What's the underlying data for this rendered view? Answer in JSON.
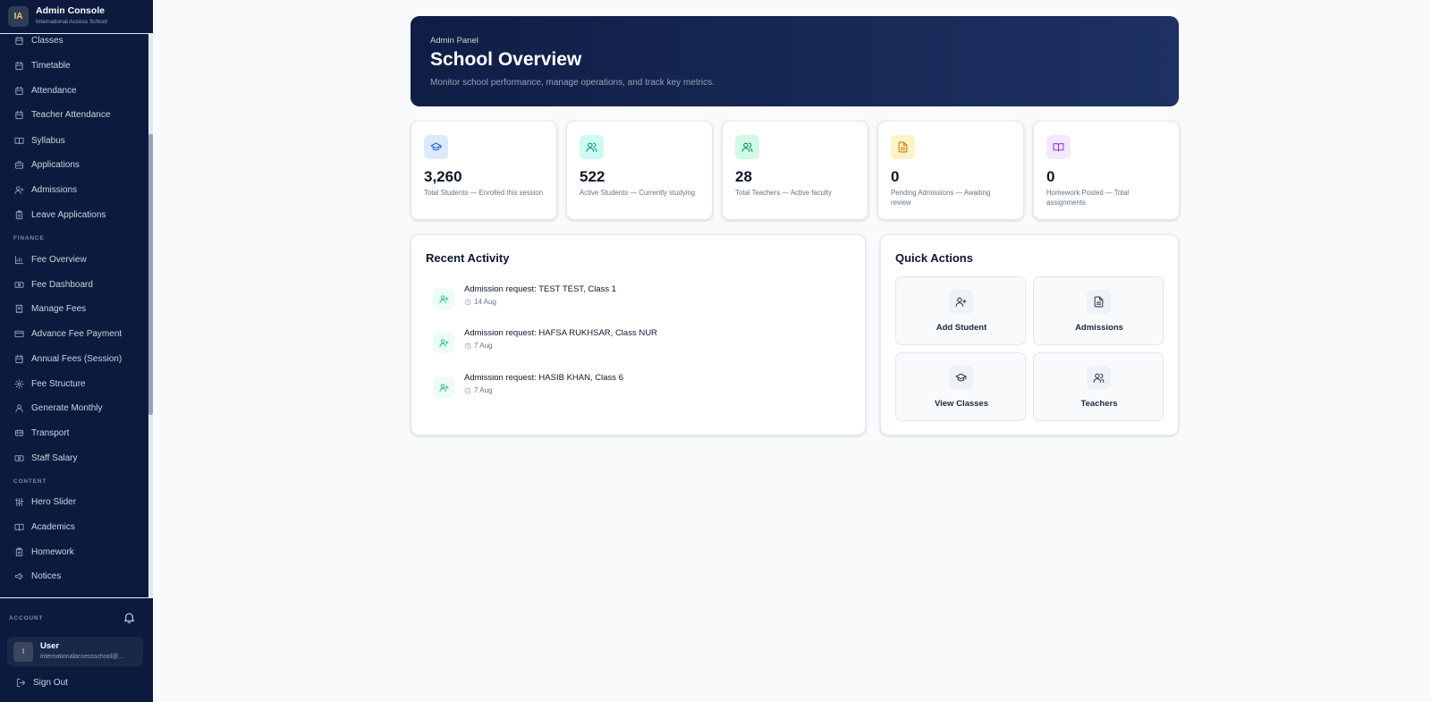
{
  "brand": {
    "logo_text": "IA",
    "title": "Admin Console",
    "subtitle": "International Access School"
  },
  "sidebar": {
    "items": [
      {
        "label": "Classes",
        "icon": "calendar-icon"
      },
      {
        "label": "Timetable",
        "icon": "calendar-icon"
      },
      {
        "label": "Attendance",
        "icon": "calendar-icon"
      },
      {
        "label": "Teacher Attendance",
        "icon": "calendar-icon"
      },
      {
        "label": "Syllabus",
        "icon": "book-open-icon"
      },
      {
        "label": "Applications",
        "icon": "briefcase-icon"
      },
      {
        "label": "Admissions",
        "icon": "user-plus-icon"
      },
      {
        "label": "Leave Applications",
        "icon": "clipboard-icon"
      }
    ],
    "finance_heading": "FINANCE",
    "finance_items": [
      {
        "label": "Fee Overview",
        "icon": "bar-chart-icon"
      },
      {
        "label": "Fee Dashboard",
        "icon": "banknote-icon"
      },
      {
        "label": "Manage Fees",
        "icon": "receipt-icon"
      },
      {
        "label": "Advance Fee Payment",
        "icon": "credit-card-icon"
      },
      {
        "label": "Annual Fees (Session)",
        "icon": "calendar-icon"
      },
      {
        "label": "Fee Structure",
        "icon": "settings-icon"
      },
      {
        "label": "Generate Monthly",
        "icon": "user-icon"
      },
      {
        "label": "Transport",
        "icon": "bus-icon"
      },
      {
        "label": "Staff Salary",
        "icon": "banknote-icon"
      }
    ],
    "content_heading": "CONTENT",
    "content_items": [
      {
        "label": "Hero Slider",
        "icon": "sliders-icon"
      },
      {
        "label": "Academics",
        "icon": "book-open-icon"
      },
      {
        "label": "Homework",
        "icon": "clipboard-icon"
      },
      {
        "label": "Notices",
        "icon": "megaphone-icon"
      }
    ]
  },
  "account": {
    "heading": "ACCOUNT",
    "avatar_initial": "I",
    "user_name": "User",
    "user_email": "internationalaccessschool@...",
    "sign_out": "Sign Out"
  },
  "hero": {
    "eyebrow": "Admin Panel",
    "title": "School Overview",
    "subtitle": "Monitor school performance, manage operations, and track key metrics."
  },
  "stats": [
    {
      "value": "3,260",
      "label": "Total Students — Enrolled this session",
      "icon": "graduation-cap-icon",
      "color": "#2563eb",
      "bg": "#dbeafe"
    },
    {
      "value": "522",
      "label": "Active Students — Currently studying",
      "icon": "users-icon",
      "color": "#0d9488",
      "bg": "#ccfbf1"
    },
    {
      "value": "28",
      "label": "Total Teachers — Active faculty",
      "icon": "users-icon",
      "color": "#059669",
      "bg": "#d1fae5"
    },
    {
      "value": "0",
      "label": "Pending Admissions — Awaiting review",
      "icon": "file-text-icon",
      "color": "#d97706",
      "bg": "#fef3c7"
    },
    {
      "value": "0",
      "label": "Homework Posted — Total assignments",
      "icon": "book-open-icon",
      "color": "#9333ea",
      "bg": "#f3e8ff"
    }
  ],
  "recent_activity": {
    "title": "Recent Activity",
    "items": [
      {
        "text": "Admission request: TEST TEST, Class 1",
        "time": "14 Aug"
      },
      {
        "text": "Admission request: HAFSA RUKHSAR, Class NUR",
        "time": "7 Aug"
      },
      {
        "text": "Admission request: HASIB KHAN, Class 6",
        "time": "7 Aug"
      }
    ]
  },
  "quick_actions": {
    "title": "Quick Actions",
    "items": [
      {
        "label": "Add Student",
        "icon": "user-plus-icon"
      },
      {
        "label": "Admissions",
        "icon": "file-text-icon"
      },
      {
        "label": "View Classes",
        "icon": "graduation-cap-icon"
      },
      {
        "label": "Teachers",
        "icon": "users-icon"
      }
    ]
  }
}
